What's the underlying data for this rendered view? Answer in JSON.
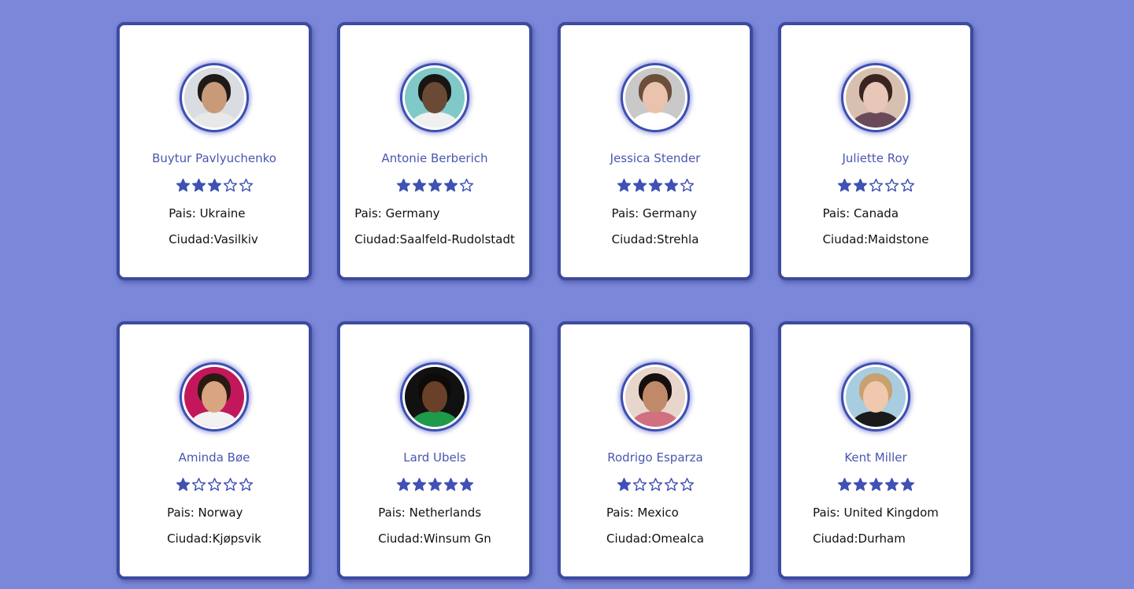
{
  "colors": {
    "background": "#7b87d9",
    "card_border": "#3d4a9e",
    "name_text": "#4a56b0",
    "star": "#3f51b5"
  },
  "labels": {
    "country_prefix": "Pais: ",
    "city_prefix": "Ciudad:"
  },
  "max_stars": 5,
  "users": [
    {
      "name": "Buytur Pavlyuchenko",
      "rating": 3,
      "country": "Ukraine",
      "city": "Vasilkiv",
      "avatar": {
        "bg": "#d9dce0",
        "hair": "#1f1a17",
        "skin": "#c99a78",
        "shirt": "#e8e8e8"
      }
    },
    {
      "name": "Antonie Berberich",
      "rating": 4,
      "country": "Germany",
      "city": "Saalfeld-Rudolstadt",
      "avatar": {
        "bg": "#7fc9c8",
        "hair": "#1a1412",
        "skin": "#6b4a35",
        "shirt": "#f0f0f0"
      }
    },
    {
      "name": "Jessica Stender",
      "rating": 4,
      "country": "Germany",
      "city": "Strehla",
      "avatar": {
        "bg": "#c9c9c9",
        "hair": "#6b4f3a",
        "skin": "#e9c3ad",
        "shirt": "#ffffff"
      }
    },
    {
      "name": "Juliette Roy",
      "rating": 2,
      "country": "Canada",
      "city": "Maidstone",
      "avatar": {
        "bg": "#d8c0b0",
        "hair": "#3a2420",
        "skin": "#e8c6b8",
        "shirt": "#6a4a5a"
      }
    },
    {
      "name": "Aminda Bøe",
      "rating": 1,
      "country": "Norway",
      "city": "Kjøpsvik",
      "avatar": {
        "bg": "#c2185b",
        "hair": "#2a1a12",
        "skin": "#d9a580",
        "shirt": "#f2f2f2"
      }
    },
    {
      "name": "Lard Ubels",
      "rating": 5,
      "country": "Netherlands",
      "city": "Winsum Gn",
      "avatar": {
        "bg": "#111111",
        "hair": "#0e0a08",
        "skin": "#6a4028",
        "shirt": "#1f9a4a"
      }
    },
    {
      "name": "Rodrigo Esparza",
      "rating": 1,
      "country": "Mexico",
      "city": "Omealca",
      "avatar": {
        "bg": "#e8d6cc",
        "hair": "#15100e",
        "skin": "#c08a6a",
        "shirt": "#d07080"
      }
    },
    {
      "name": "Kent Miller",
      "rating": 5,
      "country": "United Kingdom",
      "city": "Durham",
      "avatar": {
        "bg": "#a9cde0",
        "hair": "#c9a070",
        "skin": "#efc8ad",
        "shirt": "#1a1a1a"
      }
    }
  ]
}
